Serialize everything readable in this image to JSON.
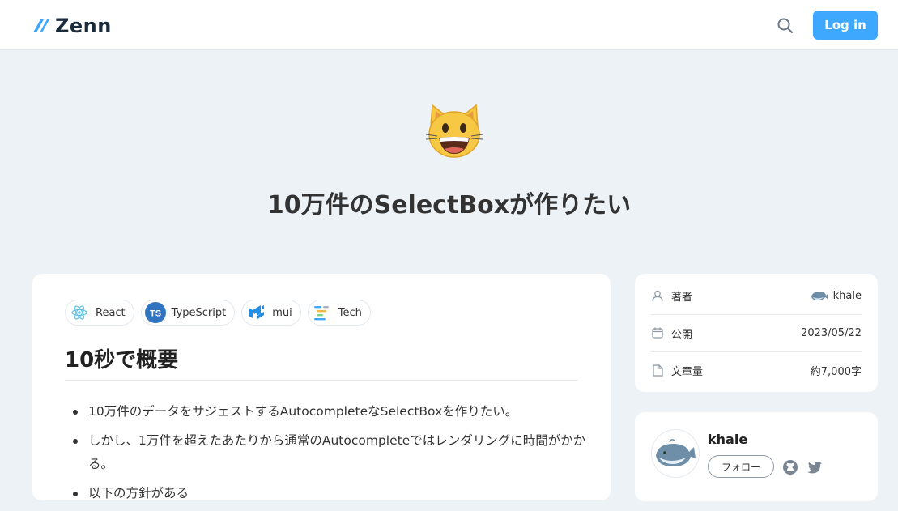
{
  "header": {
    "logo_text": "Zenn",
    "search_icon": "search-icon",
    "login_label": "Log in",
    "accent": "#3ea8ff"
  },
  "article": {
    "emoji": "grinning-cat-emoji",
    "title": "10万件のSelectBoxが作りたい",
    "tags": [
      {
        "label": "React",
        "icon": "react-icon"
      },
      {
        "label": "TypeScript",
        "icon": "typescript-icon"
      },
      {
        "label": "mui",
        "icon": "mui-icon"
      },
      {
        "label": "Tech",
        "icon": "tech-icon"
      }
    ],
    "section_heading": "10秒で概要",
    "bullets": [
      "10万件のデータをサジェストするAutocompleteなSelectBoxを作りたい。",
      "しかし、1万件を超えたあたりから通常のAutocompleteではレンダリングに時間がかかる。",
      "以下の方針がある"
    ]
  },
  "info": {
    "author_label": "著者",
    "author_value": "khale",
    "published_label": "公開",
    "published_value": "2023/05/22",
    "length_label": "文章量",
    "length_value": "約7,000字"
  },
  "author_card": {
    "name": "khale",
    "follow_label": "フォロー",
    "social_icons": [
      "github-icon",
      "twitter-icon"
    ]
  }
}
